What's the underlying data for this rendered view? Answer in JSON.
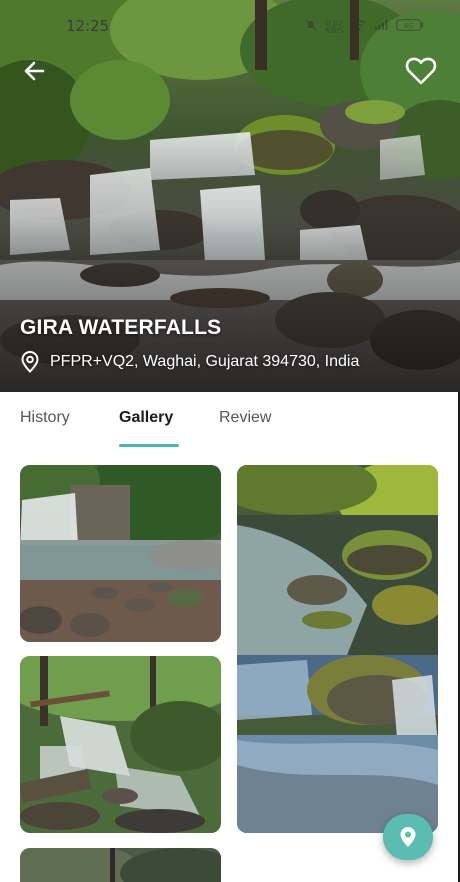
{
  "status_bar": {
    "time": "12:25",
    "network_speed_value": "0.02",
    "network_speed_unit": "KB/S",
    "battery_label": "6G"
  },
  "header": {
    "back_icon": "arrow-left-icon",
    "favorite_icon": "heart-outline-icon"
  },
  "place": {
    "name": "GIRA WATERFALLS",
    "address": "PFPR+VQ2, Waghai, Gujarat 394730, India",
    "address_icon": "location-pin-icon"
  },
  "tabs": [
    {
      "label": "History",
      "active": false
    },
    {
      "label": "Gallery",
      "active": true
    },
    {
      "label": "Review",
      "active": false
    }
  ],
  "accent_color": "#4bb5b5",
  "fab": {
    "icon": "location-pin-icon",
    "color": "#5bbcb2"
  },
  "gallery": {
    "photos": [
      {
        "subject": "waterfall-pool"
      },
      {
        "subject": "mossy-cascade"
      },
      {
        "subject": "forest-stream"
      },
      {
        "subject": "forest-partial"
      }
    ]
  }
}
